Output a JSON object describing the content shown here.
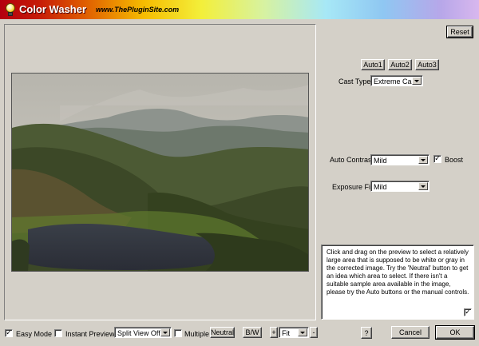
{
  "app": {
    "title": "Color Washer",
    "url": "www.ThePluginSite.com"
  },
  "controls": {
    "reset_label": "Reset",
    "auto1_label": "Auto1",
    "auto2_label": "Auto2",
    "auto3_label": "Auto3",
    "cast_type_label": "Cast Type",
    "cast_type_value": "Extreme Cast",
    "auto_contrast_label": "Auto Contrast",
    "auto_contrast_value": "Mild",
    "boost_label": "Boost",
    "boost_checked": true,
    "exposure_fix_label": "Exposure Fix",
    "exposure_fix_value": "Mild"
  },
  "help": {
    "text": "Click and drag on the preview to select a relatively large area that is supposed to be white or gray in the corrected image. Try the 'Neutral' button to get an idea which area to select. If there isn't a suitable sample area available in the image, please try the Auto buttons or the manual controls.",
    "checked": true
  },
  "bottom": {
    "easy_mode_label": "Easy Mode",
    "easy_mode_checked": true,
    "instant_preview_label": "Instant Preview",
    "instant_preview_checked": false,
    "split_view_value": "Split View Off",
    "multiple_label": "Multiple",
    "multiple_checked": false,
    "neutral_label": "Neutral",
    "bw_label": "B/W",
    "zoom_in_label": "+",
    "zoom_value": "Fit",
    "zoom_out_label": "-",
    "help_label": "?",
    "cancel_label": "Cancel",
    "ok_label": "OK"
  },
  "colors": {
    "window_bg": "#d4d0c8",
    "title_gradient_start": "#b3000e",
    "title_gradient_end": "#d8b7ee"
  }
}
